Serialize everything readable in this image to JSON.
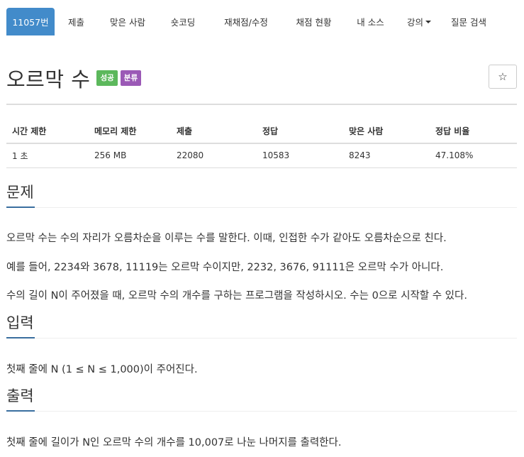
{
  "nav": {
    "tabs": [
      {
        "label": "11057번"
      },
      {
        "label": "제출"
      },
      {
        "label": "맞은 사람"
      },
      {
        "label": "숏코딩"
      },
      {
        "label": "재채점/수정"
      },
      {
        "label": "채점 현황"
      },
      {
        "label": "내 소스"
      },
      {
        "label": "강의"
      },
      {
        "label": "질문 검색"
      }
    ]
  },
  "problem": {
    "title": "오르막 수",
    "badges": {
      "status": "성공",
      "category": "분류"
    },
    "star": "☆"
  },
  "info_table": {
    "headers": [
      "시간 제한",
      "메모리 제한",
      "제출",
      "정답",
      "맞은 사람",
      "정답 비율"
    ],
    "values": [
      "1 초",
      "256 MB",
      "22080",
      "10583",
      "8243",
      "47.108%"
    ]
  },
  "sections": {
    "problem_heading": "문제",
    "problem_paragraphs": [
      "오르막 수는 수의 자리가 오름차순을 이루는 수를 말한다. 이때, 인접한 수가 같아도 오름차순으로 친다.",
      "예를 들어, 2234와 3678, 11119는 오르막 수이지만, 2232, 3676, 91111은 오르막 수가 아니다.",
      "수의 길이 N이 주어졌을 때, 오르막 수의 개수를 구하는 프로그램을 작성하시오. 수는 0으로 시작할 수 있다."
    ],
    "input_heading": "입력",
    "input_text": "첫째 줄에 N (1 ≤ N ≤ 1,000)이 주어진다.",
    "output_heading": "출력",
    "output_text": "첫째 줄에 길이가 N인 오르막 수의 개수를 10,007로 나눈 나머지를 출력한다."
  }
}
